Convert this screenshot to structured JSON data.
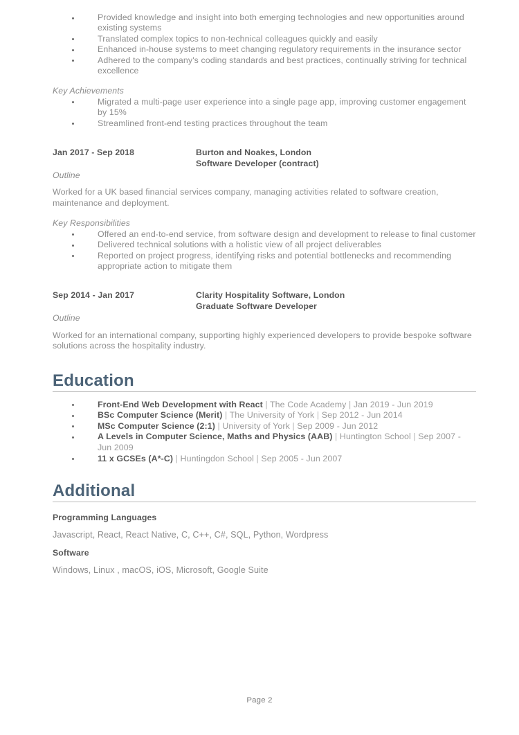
{
  "document": {
    "footer_label": "Page 2"
  },
  "continued_role": {
    "responsibilities": [
      "Provided knowledge and insight into both emerging technologies and new opportunities around existing systems",
      "Translated complex topics to non-technical colleagues quickly and easily",
      "Enhanced in-house systems to meet changing regulatory requirements in the insurance sector",
      "Adhered to the company's coding standards and best practices, continually striving for technical excellence"
    ],
    "achievements_heading": "Key Achievements",
    "achievements": [
      "Migrated a multi-page user experience into a single page app, improving customer engagement by 15%",
      "Streamlined front-end testing practices throughout the team"
    ]
  },
  "experience": [
    {
      "dates": "Jan 2017 - Sep 2018",
      "company": "Burton and Noakes, London",
      "title": "Software Developer (contract)",
      "outline_heading": "Outline",
      "outline": "Worked for a UK based financial services company, managing activities related to software creation, maintenance and deployment.",
      "responsibilities_heading": "Key Responsibilities",
      "responsibilities": [
        "Offered an end-to-end service, from software design and development to release to final customer",
        "Delivered technical solutions with a holistic view of all project deliverables",
        "Reported on project progress, identifying risks and potential bottlenecks and recommending appropriate action to mitigate them"
      ]
    },
    {
      "dates": "Sep 2014 - Jan 2017",
      "company": "Clarity Hospitality Software, London",
      "title": "Graduate Software Developer",
      "outline_heading": "Outline",
      "outline": "Worked for an international company, supporting highly experienced developers to provide bespoke software solutions across the hospitality industry."
    }
  ],
  "education": {
    "heading": "Education",
    "items": [
      {
        "qualification": "Front-End Web Development with React",
        "institution": "The Code Academy",
        "dates": "Jan 2019 - Jun 2019"
      },
      {
        "qualification": "BSc Computer Science (Merit)",
        "institution": "The University of York",
        "dates": "Sep 2012 - Jun 2014"
      },
      {
        "qualification": "MSc Computer Science (2:1)",
        "institution": "University of York",
        "dates": "Sep 2009 - Jun 2012"
      },
      {
        "qualification": "A Levels in Computer Science, Maths and Physics (AAB)",
        "institution": "Huntington School",
        "dates": "Sep 2007 - Jun 2009"
      },
      {
        "qualification": "11 x GCSEs (A*-C)",
        "institution": "Huntingdon School",
        "dates": "Sep 2005 - Jun 2007"
      }
    ],
    "separator": "|"
  },
  "additional": {
    "heading": "Additional",
    "groups": [
      {
        "label": "Programming Languages",
        "value": "Javascript, React, React Native, C, C++, C#, SQL, Python, Wordpress"
      },
      {
        "label": "Software",
        "value": "Windows, Linux , macOS, iOS, Microsoft, Google Suite"
      }
    ]
  },
  "colors": {
    "heading": "#4c6377",
    "bold_text": "#585858",
    "body_text": "#8d8d8d",
    "rule": "#b9b9b9"
  }
}
